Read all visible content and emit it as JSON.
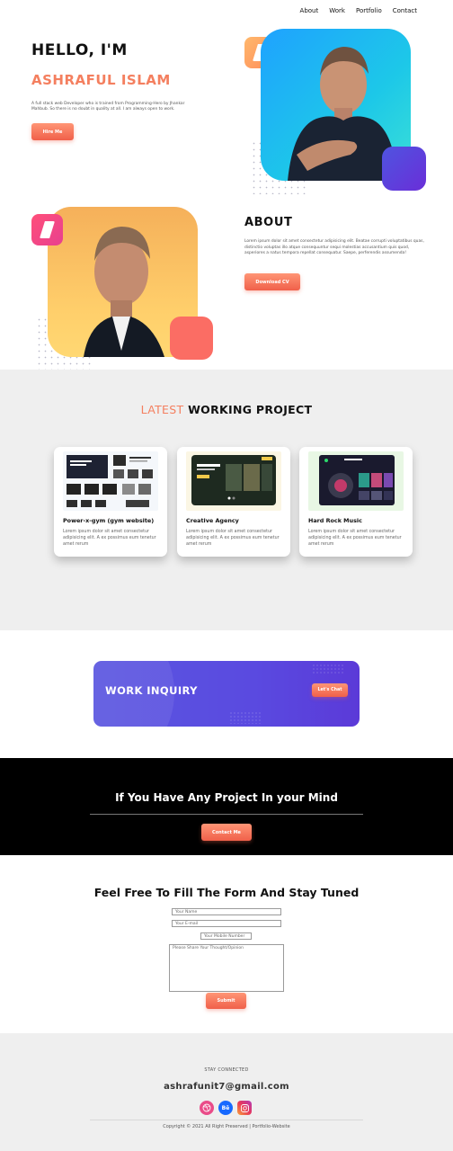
{
  "nav": {
    "items": [
      {
        "label": "About"
      },
      {
        "label": "Work"
      },
      {
        "label": "Portfolio"
      },
      {
        "label": "Contact"
      }
    ]
  },
  "hero": {
    "greeting": "HELLO, I'M",
    "name": "ASHRAFUL ISLAM",
    "description": "A full stack web Developer who is trained from Programming-Hero by Jhankar Mahbub. So there is no doubt in quality at all. I am always open to work.",
    "hire_label": "Hire Me"
  },
  "about": {
    "title": "ABOUT",
    "description": "Lorem ipsum dolor sit amet consectetur adipisicing elit. Beatae corrupti voluptatibus quas, distinctio voluptas illo atque consequuntur sequi molestias accusantium quis quod, asperiores a natus tempora repellat consequatur. Saepe, perferendis assumenda!",
    "download_label": "Download CV"
  },
  "projects": {
    "title_accent": "LATEST",
    "title_rest": "WORKING PROJECT",
    "cards": [
      {
        "title": "Power-x-gym (gym website)",
        "description": "Lorem ipsum dolor sit amet consectetur adipisicing elit. A ex possimus eum tenetur amet rerum"
      },
      {
        "title": "Creative Agency",
        "description": "Lorem ipsum dolor sit amet consectetur adipisicing elit. A ex possimus eum tenetur amet rerum"
      },
      {
        "title": "Hard Rock Music",
        "description": "Lorem ipsum dolor sit amet consectetur adipisicing elit. A ex possimus eum tenetur amet rerum"
      }
    ]
  },
  "inquiry": {
    "title": "WORK INQUIRY",
    "chat_label": "Let's Chat"
  },
  "cta": {
    "title": "If You Have Any Project In your Mind",
    "contact_label": "Contact Me"
  },
  "form": {
    "title": "Feel Free To Fill The Form And Stay Tuned",
    "name_placeholder": "Your Name",
    "email_placeholder": "Your E-mail",
    "mobile_placeholder": "Your Mobile Number",
    "message_placeholder": "Please Share Your Thought/Opinion",
    "submit_label": "Submit"
  },
  "footer": {
    "stay_connected": "STAY CONNECTED",
    "email": "ashrafunit7@gmail.com",
    "socials": [
      {
        "icon": "dribbble-icon"
      },
      {
        "icon": "behance-icon",
        "label": "Bē"
      },
      {
        "icon": "instagram-icon"
      }
    ],
    "copyright": "Copyright © 2021 All Right Preserved | Portfolio-Website"
  },
  "colors": {
    "accent": "#f47f5f",
    "inquiry_bg": "#5a4ae0",
    "cta_bg": "#000000"
  }
}
